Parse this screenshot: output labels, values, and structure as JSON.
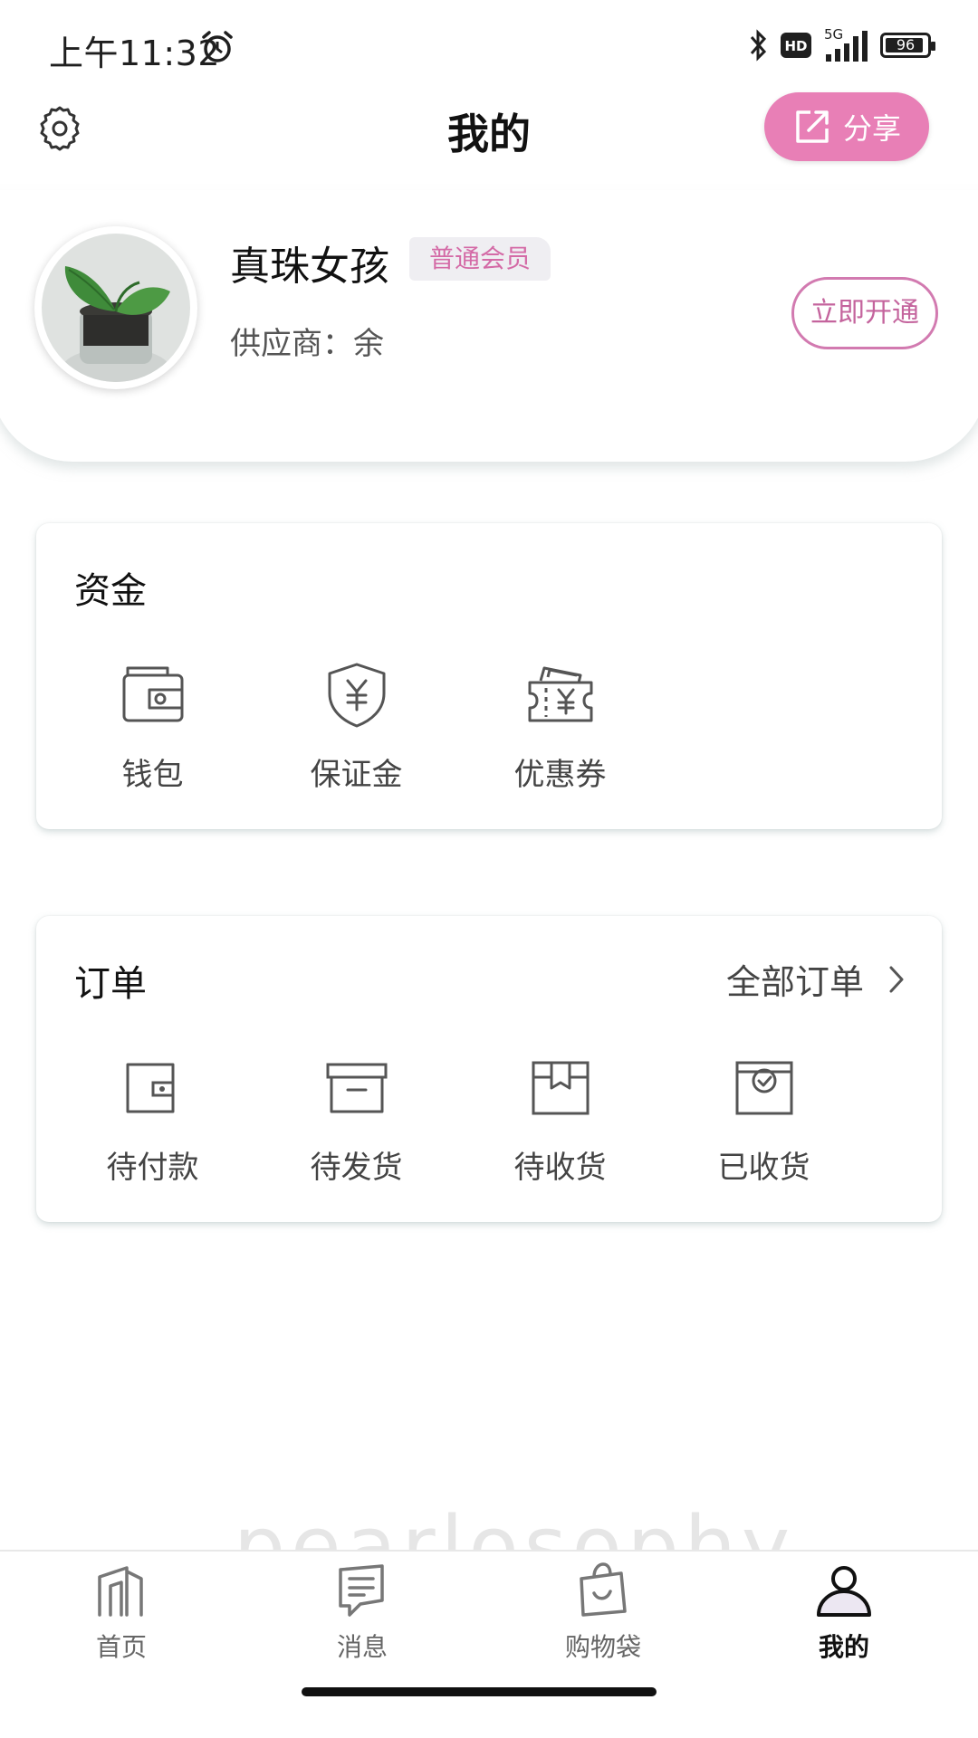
{
  "status_bar": {
    "time": "上午11:32",
    "network": "5G",
    "hd": "HD",
    "battery": "96"
  },
  "header": {
    "title": "我的",
    "share_label": "分享"
  },
  "profile": {
    "name": "真珠女孩",
    "badge": "普通会员",
    "supplier": "供应商：余",
    "open_label": "立即开通"
  },
  "funds": {
    "title": "资金",
    "items": [
      {
        "label": "钱包",
        "icon": "wallet-icon"
      },
      {
        "label": "保证金",
        "icon": "shield-yen-icon"
      },
      {
        "label": "优惠券",
        "icon": "coupon-icon"
      }
    ]
  },
  "orders": {
    "title": "订单",
    "all_label": "全部订单",
    "items": [
      {
        "label": "待付款",
        "icon": "pending-payment-icon"
      },
      {
        "label": "待发货",
        "icon": "pending-shipment-icon"
      },
      {
        "label": "待收货",
        "icon": "pending-receipt-icon"
      },
      {
        "label": "已收货",
        "icon": "received-icon"
      }
    ]
  },
  "watermark": "pearlosophy",
  "bottom_nav": [
    {
      "label": "首页",
      "icon": "home-icon"
    },
    {
      "label": "消息",
      "icon": "message-icon"
    },
    {
      "label": "购物袋",
      "icon": "shopping-bag-icon"
    },
    {
      "label": "我的",
      "icon": "profile-icon",
      "active": true
    }
  ],
  "colors": {
    "accent": "#e87fb6",
    "badge_text": "#d46aa6",
    "badge_bg": "#efeef2"
  }
}
